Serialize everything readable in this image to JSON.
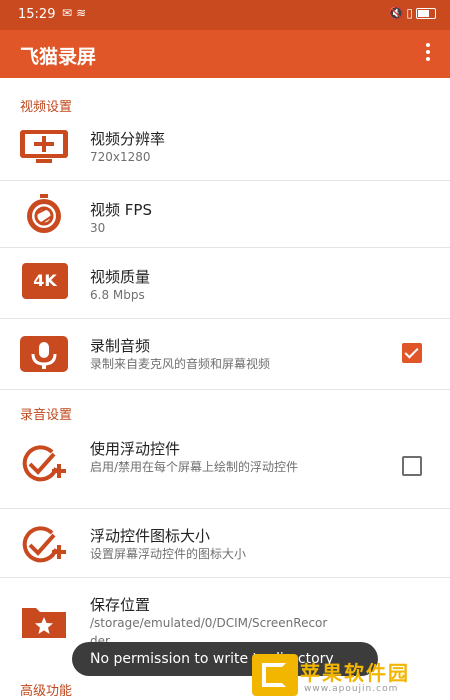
{
  "status_bar": {
    "time": "15:29"
  },
  "app_bar": {
    "title": "飞猫录屏"
  },
  "sections": {
    "video": "视频设置",
    "audio": "录音设置",
    "advanced": "高级功能"
  },
  "rows": [
    {
      "title": "视频分辨率",
      "subtitle": "720x1280"
    },
    {
      "title": "视频 FPS",
      "subtitle": "30"
    },
    {
      "title": "视频质量",
      "subtitle": "6.8 Mbps",
      "icon_text": "4K"
    },
    {
      "title": "录制音频",
      "subtitle": "录制来自麦克风的音频和屏幕视频",
      "checked": true
    },
    {
      "title": "使用浮动控件",
      "subtitle": "启用/禁用在每个屏幕上绘制的浮动控件",
      "checked": false
    },
    {
      "title": "浮动控件图标大小",
      "subtitle": "设置屏幕浮动控件的图标大小"
    },
    {
      "title": "保存位置",
      "subtitle": "/storage/emulated/0/DCIM/ScreenRecorder"
    }
  ],
  "toast": {
    "message": "No permission to write to directory"
  },
  "watermark": {
    "text": "苹果软件园",
    "url": "www.apoujin.com"
  },
  "colors": {
    "accent": "#e05628",
    "status_bar": "#c94a1f",
    "section_text": "#c0481d",
    "watermark": "#f2b600"
  }
}
